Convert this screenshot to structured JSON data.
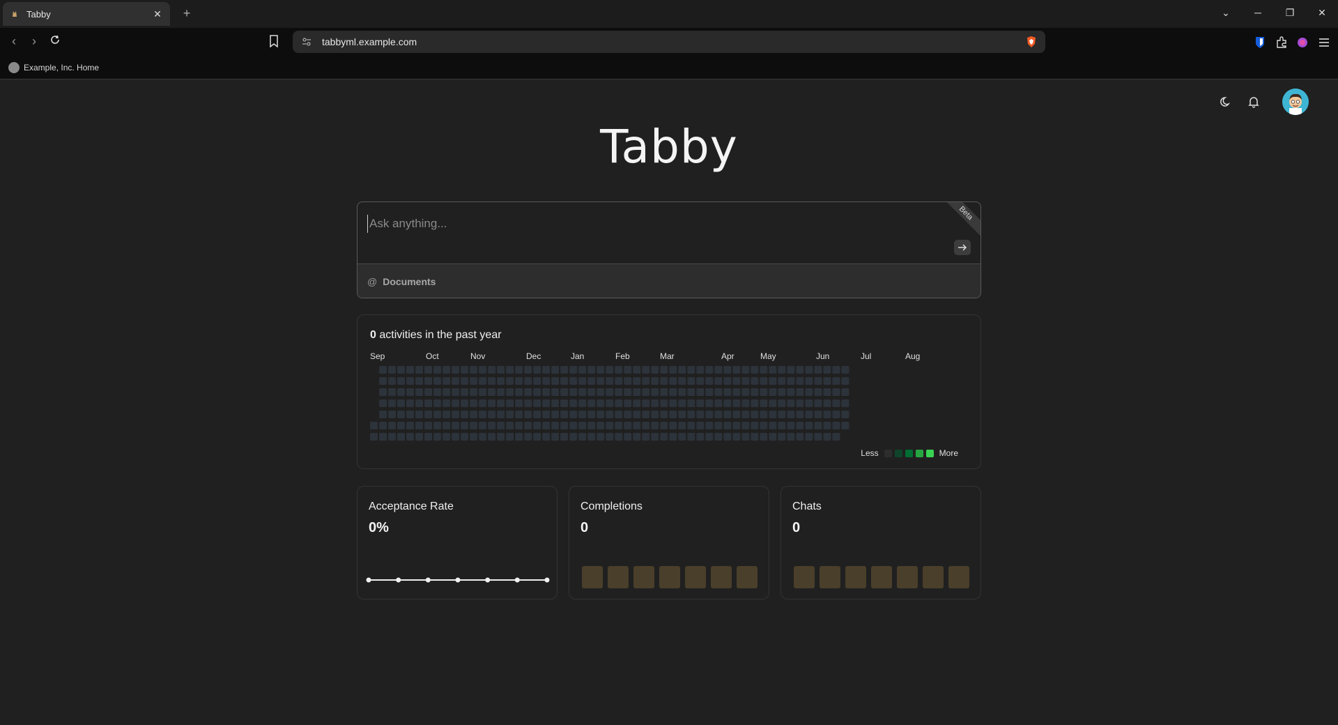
{
  "browser": {
    "tab_title": "Tabby",
    "url": "tabbyml.example.com",
    "bookmark_label": "Example, Inc. Home"
  },
  "app": {
    "brand": "Tabby",
    "ask_placeholder": "Ask anything...",
    "beta_label": "Beta",
    "documents_label": "Documents"
  },
  "activity": {
    "count": "0",
    "title_suffix": " activities in the past year",
    "months": [
      "Sep",
      "Oct",
      "Nov",
      "Dec",
      "Jan",
      "Feb",
      "Mar",
      "Apr",
      "May",
      "Jun",
      "Jul",
      "Aug"
    ],
    "legend_less": "Less",
    "legend_more": "More",
    "legend_colors": [
      "#2d2d2d",
      "#0e4429",
      "#006d32",
      "#26a641",
      "#39d353"
    ],
    "empty_cell_color": "#2d333b"
  },
  "stats": {
    "acceptance": {
      "label": "Acceptance Rate",
      "value": "0%"
    },
    "completions": {
      "label": "Completions",
      "value": "0"
    },
    "chats": {
      "label": "Chats",
      "value": "0"
    }
  }
}
